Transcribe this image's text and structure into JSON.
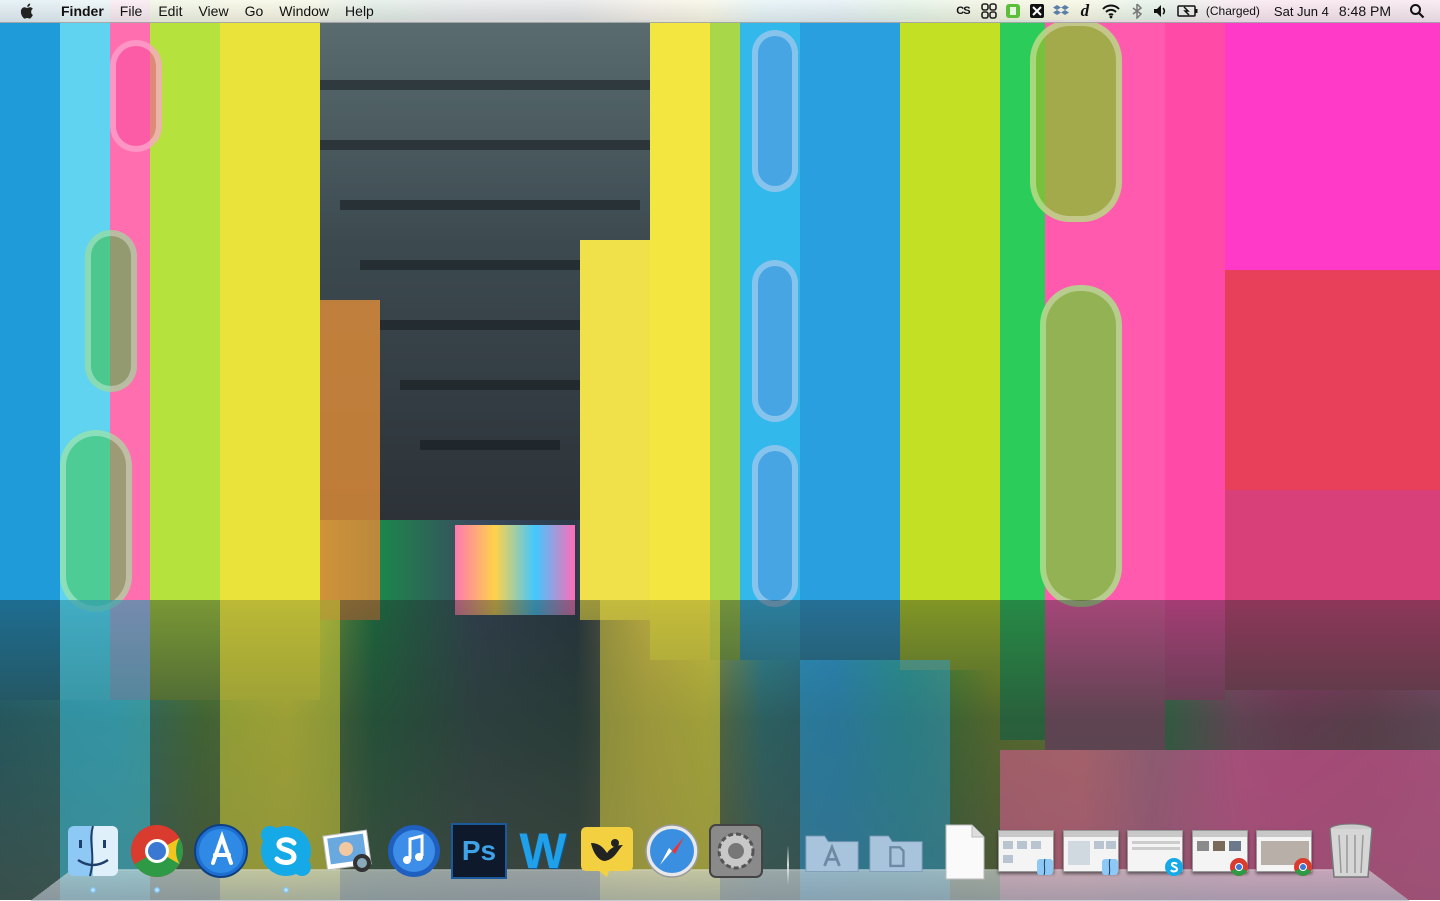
{
  "menubar": {
    "apple_icon": "apple-logo",
    "app_name": "Finder",
    "menus": [
      "File",
      "Edit",
      "View",
      "Go",
      "Window",
      "Help"
    ],
    "status_icons": [
      "cs-icon",
      "grid-icon",
      "evernote-icon",
      "x-icon",
      "dropbox-icon",
      "d-icon",
      "wifi-icon",
      "bluetooth-icon",
      "volume-icon",
      "battery-icon"
    ],
    "cs_label": "CS",
    "d_label": "d",
    "battery_status": "(Charged)",
    "date": "Sat Jun 4",
    "time": "8:48 PM",
    "spotlight_icon": "magnifier-icon"
  },
  "dock": {
    "apps": [
      {
        "name": "finder",
        "running": true
      },
      {
        "name": "chrome",
        "running": true
      },
      {
        "name": "app-store",
        "running": false
      },
      {
        "name": "skype",
        "running": true
      },
      {
        "name": "iphoto",
        "running": false
      },
      {
        "name": "itunes",
        "running": false
      },
      {
        "name": "photoshop",
        "running": false
      },
      {
        "name": "word",
        "running": false
      },
      {
        "name": "twitter",
        "running": false
      },
      {
        "name": "safari",
        "running": false
      },
      {
        "name": "system-preferences",
        "running": false
      }
    ],
    "ps_label": "Ps",
    "w_label": "W",
    "stacks": [
      "applications-folder",
      "documents-folder",
      "document-stack"
    ],
    "minimized_windows": [
      "finder-window-1",
      "finder-window-2",
      "skype-window",
      "chrome-window-1",
      "chrome-window-2"
    ],
    "trash": "trash-icon"
  },
  "colors": {
    "menubar_bg": "#efefef",
    "wallpaper_pink": "#ff3aa0",
    "wallpaper_green": "#36c84a",
    "wallpaper_cyan": "#3dd0f0",
    "wallpaper_yellow": "#f4f030"
  }
}
